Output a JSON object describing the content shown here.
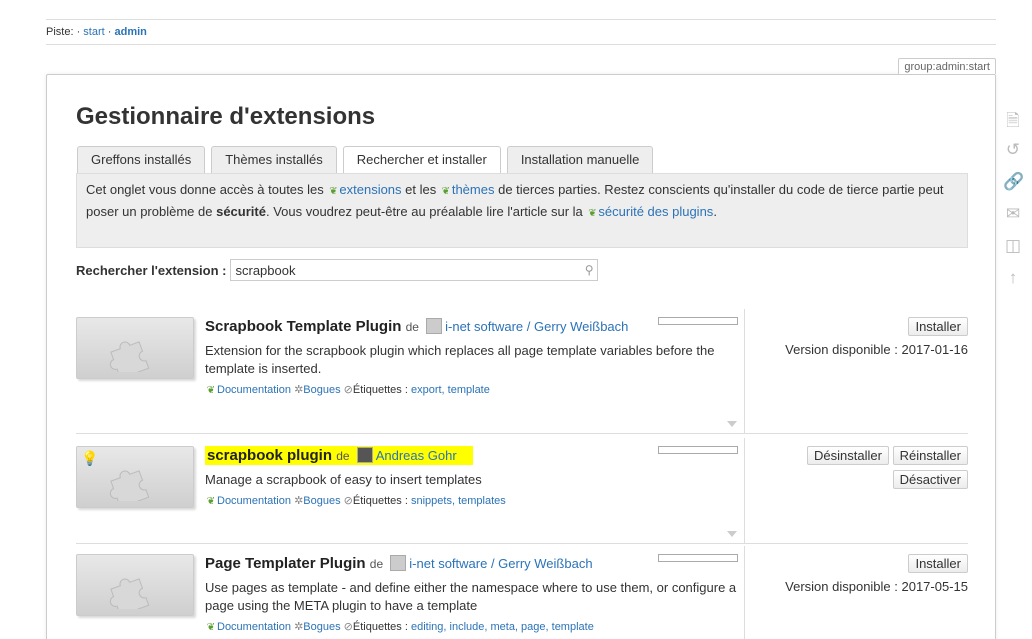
{
  "breadcrumb": {
    "label": "Piste:",
    "items": [
      "start",
      "admin"
    ]
  },
  "page_id": "group:admin:start",
  "page_title": "Gestionnaire d'extensions",
  "tabs": [
    "Greffons installés",
    "Thèmes installés",
    "Rechercher et installer",
    "Installation manuelle"
  ],
  "info": {
    "p1": "Cet onglet vous donne accès à toutes les ",
    "link1": "extensions",
    "p2": " et les ",
    "link2": "thèmes",
    "p3": " de tierces parties. Restez conscients qu'installer du code de tierce partie peut poser un problème de ",
    "bold": "sécurité",
    "p4": ". Vous voudrez peut-être au préalable lire l'article sur la ",
    "link3": "sécurité des plugins",
    "p5": "."
  },
  "search": {
    "label": "Rechercher l'extension :",
    "value": "scrapbook"
  },
  "common": {
    "by": "de",
    "doc": "Documentation",
    "bugs": "Bogues",
    "tags_label": "Étiquettes :"
  },
  "extensions": [
    {
      "name": "Scrapbook Template Plugin",
      "author": "i-net software / Gerry Weißbach",
      "desc": "Extension for the scrapbook plugin which replaces all page template variables before the template is inserted.",
      "tags": "export, template",
      "install": "Installer",
      "version": "Version disponible : 2017-01-16"
    },
    {
      "name": "scrapbook plugin",
      "author": "Andreas Gohr",
      "desc": "Manage a scrapbook of easy to insert templates",
      "tags": "snippets, templates",
      "uninstall": "Désinstaller",
      "reinstall": "Réinstaller",
      "disable": "Désactiver"
    },
    {
      "name": "Page Templater Plugin",
      "author": "i-net software / Gerry Weißbach",
      "desc": "Use pages as template - and define either the namespace where to use them, or configure a page using the META plugin to have a template",
      "tags": "editing, include, meta, page, template",
      "install": "Installer",
      "version": "Version disponible : 2017-05-15"
    }
  ],
  "colors": {
    "link": "#2b73b7",
    "highlight": "#ffff00",
    "infobox": "#eeeeee"
  },
  "side_tools": [
    "page-icon",
    "history-icon",
    "link-icon",
    "mail-icon",
    "pdf-icon",
    "arrow-up-icon"
  ]
}
